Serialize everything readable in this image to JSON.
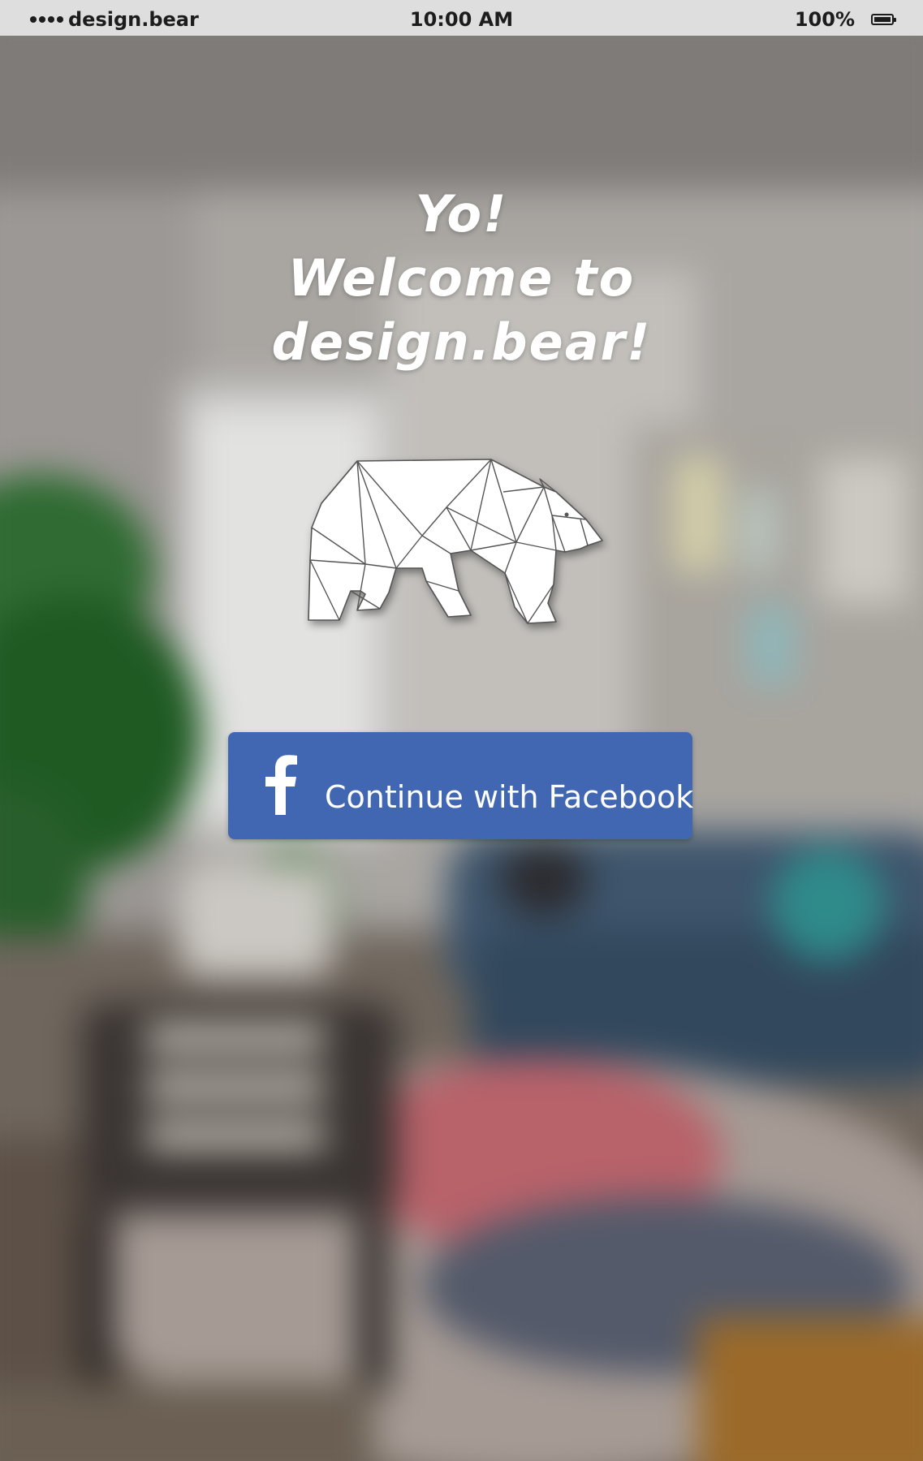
{
  "status_bar": {
    "carrier": "design.bear",
    "time": "10:00 AM",
    "battery_percent": "100%",
    "signal_icon": "signal-dots-icon",
    "battery_icon": "battery-full-icon"
  },
  "welcome": {
    "line1": "Yo!",
    "line2": "Welcome to",
    "line3": "design.bear!"
  },
  "logo": {
    "icon": "origami-bear-logo"
  },
  "facebook_button": {
    "label": "Continue with Facebook",
    "icon": "facebook-f-icon",
    "color": "#4267b2"
  }
}
